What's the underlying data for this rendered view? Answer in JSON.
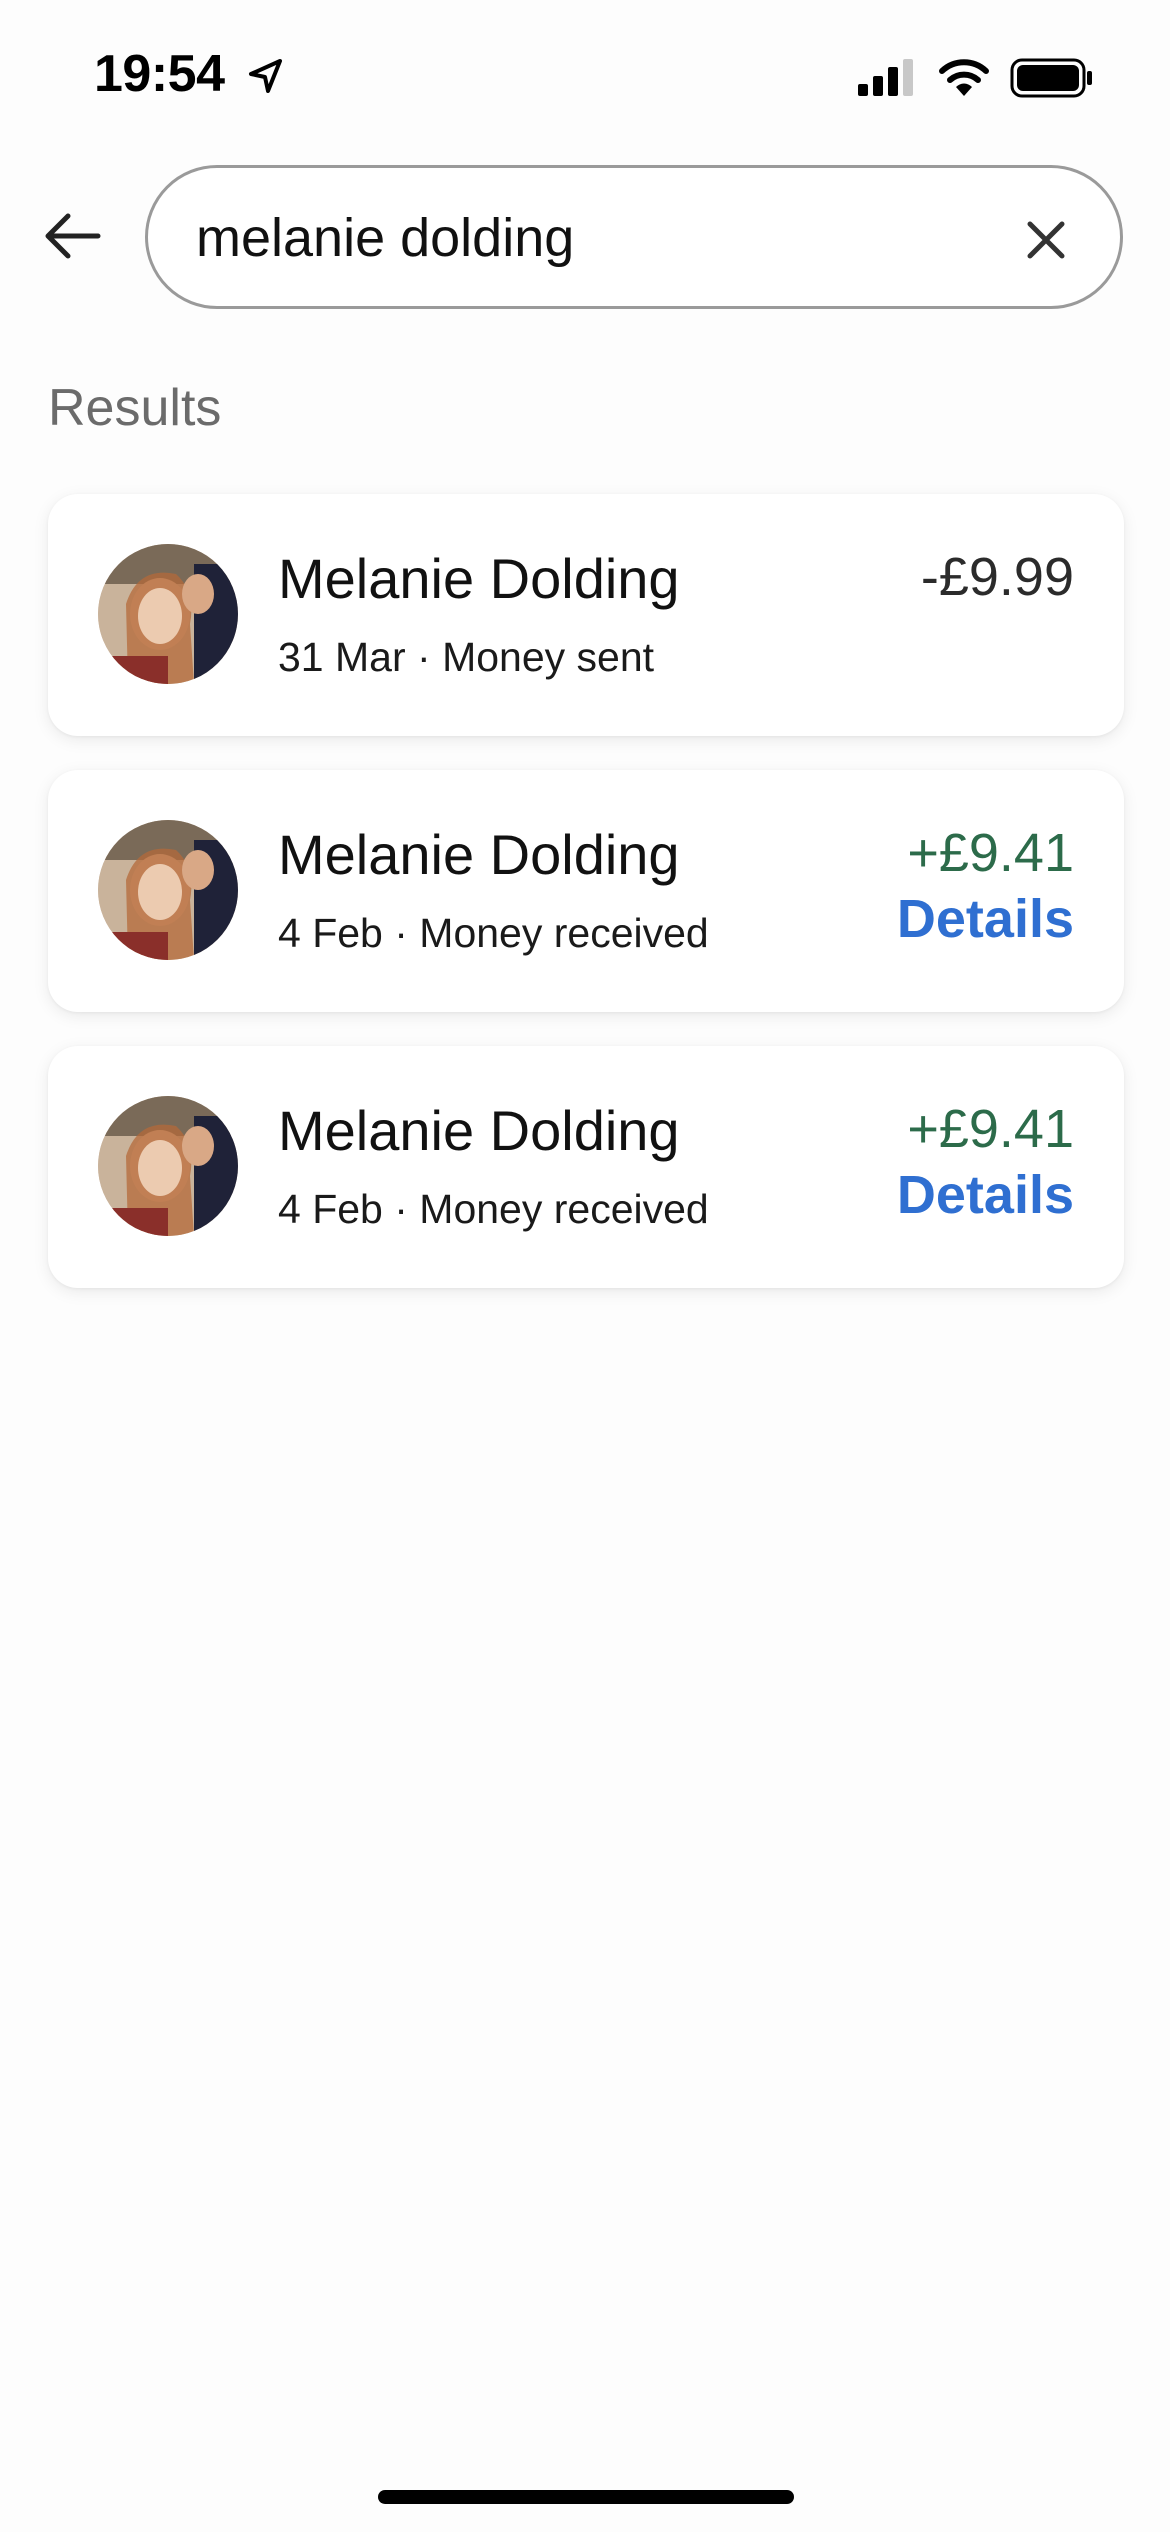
{
  "status_bar": {
    "time": "19:54",
    "icons": [
      "location-arrow-icon",
      "cellular-signal-icon",
      "wifi-icon",
      "battery-icon"
    ]
  },
  "search": {
    "value": "melanie dolding",
    "back_icon": "arrow-left-icon",
    "clear_icon": "close-icon"
  },
  "results": {
    "heading": "Results",
    "items": [
      {
        "name": "Melanie Dolding",
        "date": "31 Mar",
        "type": "Money sent",
        "amount": "-£9.99",
        "direction": "sent",
        "details_label": ""
      },
      {
        "name": "Melanie Dolding",
        "date": "4 Feb",
        "type": "Money received",
        "amount": "+£9.41",
        "direction": "received",
        "details_label": "Details"
      },
      {
        "name": "Melanie Dolding",
        "date": "4 Feb",
        "type": "Money received",
        "amount": "+£9.41",
        "direction": "received",
        "details_label": "Details"
      }
    ]
  },
  "colors": {
    "received_amount": "#2c6b4a",
    "sent_amount": "#2b2b2b",
    "link": "#2f6fd1",
    "heading": "#6b6b6b"
  }
}
